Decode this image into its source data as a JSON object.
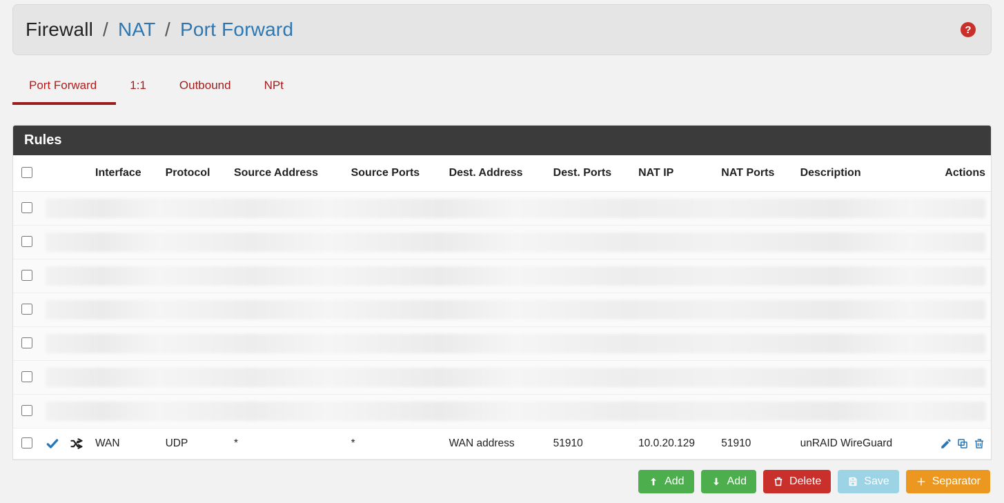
{
  "breadcrumb": {
    "root": "Firewall",
    "mid": "NAT",
    "leaf": "Port Forward"
  },
  "tabs": [
    {
      "label": "Port Forward",
      "active": true
    },
    {
      "label": "1:1",
      "active": false
    },
    {
      "label": "Outbound",
      "active": false
    },
    {
      "label": "NPt",
      "active": false
    }
  ],
  "section_title": "Rules",
  "columns": {
    "interface": "Interface",
    "protocol": "Protocol",
    "src_addr": "Source Address",
    "src_ports": "Source Ports",
    "dest_addr": "Dest. Address",
    "dest_ports": "Dest. Ports",
    "nat_ip": "NAT IP",
    "nat_ports": "NAT Ports",
    "description": "Description",
    "actions": "Actions"
  },
  "redacted_row_count": 7,
  "rule": {
    "interface": "WAN",
    "protocol": "UDP",
    "src_addr": "*",
    "src_ports": "*",
    "dest_addr": "WAN address",
    "dest_ports": "51910",
    "nat_ip": "10.0.20.129",
    "nat_ports": "51910",
    "description": "unRAID WireGuard"
  },
  "footer_buttons": {
    "add_top": "Add",
    "add_bottom": "Add",
    "delete": "Delete",
    "save": "Save",
    "separator": "Separator"
  }
}
